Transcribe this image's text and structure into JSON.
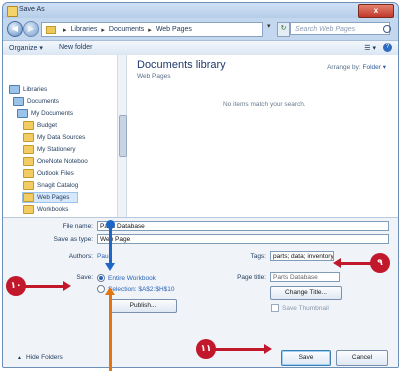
{
  "window": {
    "title": "Save As",
    "close_label": "x"
  },
  "nav": {
    "back_icon": "back-arrow-icon",
    "forward_icon": "forward-arrow-icon",
    "breadcrumb": [
      "Libraries",
      "Documents",
      "Web Pages"
    ],
    "search_placeholder": "Search Web Pages"
  },
  "toolbar": {
    "organize_label": "Organize ▾",
    "new_folder_label": "New folder",
    "views_label": "☰ ▾",
    "help_label": "?"
  },
  "tree": [
    {
      "label": "Libraries",
      "type": "lib"
    },
    {
      "label": "Documents",
      "type": "lib"
    },
    {
      "label": "My Documents",
      "type": "lib"
    },
    {
      "label": "Budget",
      "type": "folder"
    },
    {
      "label": "My Data Sources",
      "type": "folder"
    },
    {
      "label": "My Stationery",
      "type": "folder"
    },
    {
      "label": "OneNote Noteboo",
      "type": "folder"
    },
    {
      "label": "Outlook Files",
      "type": "folder"
    },
    {
      "label": "Snagit Catalog",
      "type": "folder"
    },
    {
      "label": "Web Pages",
      "type": "folder",
      "selected": true
    },
    {
      "label": "Workbooks",
      "type": "folder"
    }
  ],
  "main": {
    "library_title": "Documents library",
    "library_subtitle": "Web Pages",
    "arrange_label": "Arrange by:",
    "arrange_value": "Folder ▾",
    "empty_message": "No items match your search."
  },
  "form": {
    "file_name_label": "File name:",
    "file_name_value": "Parts Database",
    "save_as_type_label": "Save as type:",
    "save_as_type_value": "Web Page",
    "authors_label": "Authors:",
    "authors_value": "Paul",
    "tags_label": "Tags:",
    "tags_value": "parts; data; inventory",
    "save_label": "Save:",
    "radio_entire": "Entire Workbook",
    "radio_selection": "Selection: $A$2:$H$10",
    "publish_label": "Publish...",
    "page_title_label": "Page title:",
    "page_title_value": "Parts Database",
    "change_title_label": "Change Title...",
    "save_thumbnail_label": "Save Thumbnail",
    "hide_folders_label": "Hide Folders",
    "save_button": "Save",
    "cancel_button": "Cancel"
  },
  "callouts": {
    "step9": "٩",
    "step10": "١٠",
    "step11": "١١"
  },
  "colors": {
    "callout_red": "#c2182b",
    "callout_orange": "#e27412",
    "callout_blue": "#1f67c7"
  }
}
